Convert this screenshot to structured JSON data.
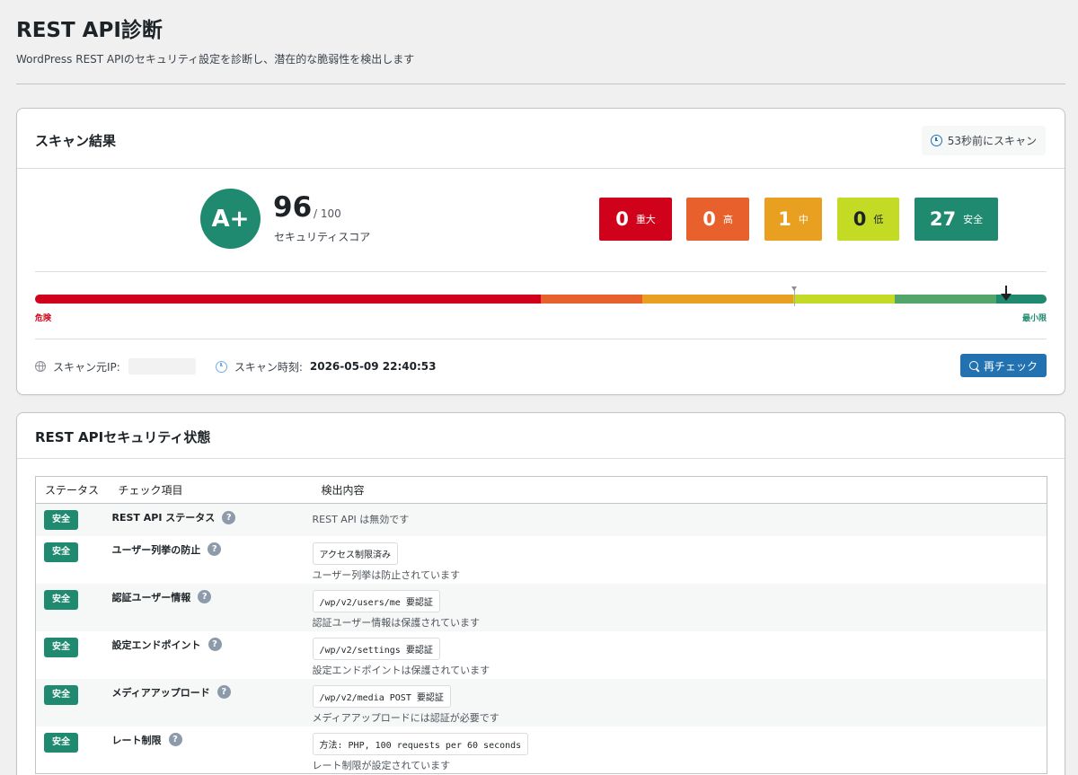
{
  "page": {
    "title": "REST API診断",
    "description": "WordPress REST APIのセキュリティ設定を診断し、潜在的な脆弱性を検出します"
  },
  "scan_card": {
    "title": "スキャン結果",
    "scanned_ago": "53秒前にスキャン",
    "grade": "A+",
    "score": "96",
    "score_max": "/ 100",
    "score_label": "セキュリティスコア",
    "severity": [
      {
        "count": "0",
        "label": "重大",
        "color": "#d0021b"
      },
      {
        "count": "0",
        "label": "高",
        "color": "#e8602c"
      },
      {
        "count": "1",
        "label": "中",
        "color": "#e9a020"
      },
      {
        "count": "0",
        "label": "低",
        "color": "#c4db26"
      },
      {
        "count": "27",
        "label": "安全",
        "color": "#1f8a6f"
      }
    ],
    "gauge_left_label": "危険",
    "gauge_right_label": "最小限",
    "gauge_position": 0.96,
    "scan_ip_label": "スキャン元IP:",
    "scan_time_label": "スキャン時刻:",
    "scan_time_value": "2026-05-09 22:40:53",
    "recheck_label": "再チェック"
  },
  "status_card": {
    "title": "REST APIセキュリティ状態",
    "columns": [
      "ステータス",
      "チェック項目",
      "検出内容"
    ],
    "rows": [
      {
        "status": "安全",
        "check": "REST API ステータス",
        "code": "",
        "detail": "REST API は無効です"
      },
      {
        "status": "安全",
        "check": "ユーザー列挙の防止",
        "code": "アクセス制限済み",
        "detail": "ユーザー列挙は防止されています"
      },
      {
        "status": "安全",
        "check": "認証ユーザー情報",
        "code": "/wp/v2/users/me 要認証",
        "detail": "認証ユーザー情報は保護されています"
      },
      {
        "status": "安全",
        "check": "設定エンドポイント",
        "code": "/wp/v2/settings 要認証",
        "detail": "設定エンドポイントは保護されています"
      },
      {
        "status": "安全",
        "check": "メディアアップロード",
        "code": "/wp/v2/media POST 要認証",
        "detail": "メディアアップロードには認証が必要です"
      },
      {
        "status": "安全",
        "check": "レート制限",
        "code": "方法: PHP, 100 requests per 60 seconds",
        "detail": "レート制限が設定されています"
      }
    ],
    "help_glyph": "?"
  }
}
